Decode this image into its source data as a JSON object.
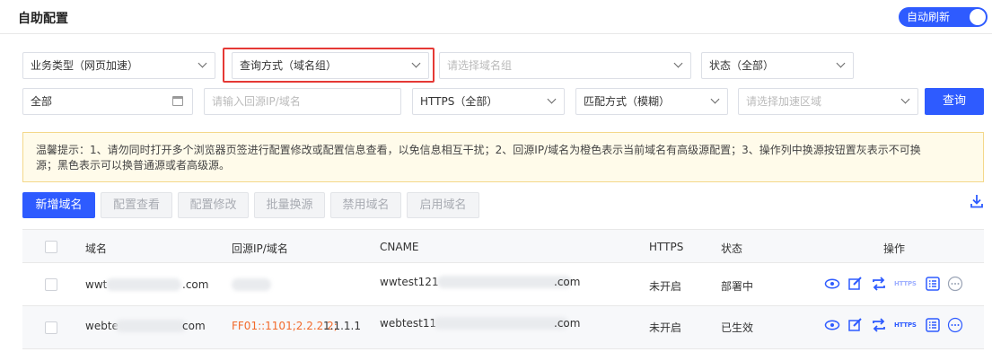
{
  "header": {
    "title": "自助配置",
    "auto_refresh": "自动刷新"
  },
  "filters": {
    "business_type": "业务类型（网页加速）",
    "query_mode": "查询方式（域名组）",
    "domain_group_placeholder": "请选择域名组",
    "status": "状态（全部）",
    "date": "全部",
    "origin_placeholder": "请输入回源IP/域名",
    "https": "HTTPS（全部）",
    "match_mode": "匹配方式（模糊）",
    "region_placeholder": "请选择加速区域",
    "query_button": "查询"
  },
  "notice": {
    "line1": "温馨提示：1、请勿同时打开多个浏览器页签进行配置修改或配置信息查看，以免信息相互干扰；2、回源IP/域名为橙色表示当前域名有高级源配置；3、操作列中换源按钮置灰表示不可换",
    "line2": "源；黑色表示可以换普通源或者高级源。"
  },
  "actions": {
    "add": "新增域名",
    "view": "配置查看",
    "edit": "配置修改",
    "batch_switch": "批量换源",
    "disable": "禁用域名",
    "enable": "启用域名"
  },
  "table": {
    "columns": {
      "domain": "域名",
      "origin": "回源IP/域名",
      "cname": "CNAME",
      "https": "HTTPS",
      "status": "状态",
      "ops": "操作"
    },
    "rows": [
      {
        "domain_prefix": "wwt",
        "domain_suffix": ".com",
        "origin": "",
        "cname_prefix": "wwtest121",
        "cname_suffix": ".com",
        "https": "未开启",
        "status": "部署中"
      },
      {
        "domain_prefix": "webte",
        "domain_suffix": "com",
        "origin": "FF01::1101;2.2.2.2;",
        "origin_tail": "1.1.1.1",
        "cname_prefix": "webtest11",
        "cname_suffix": ".com",
        "https": "未开启",
        "status": "已生效"
      }
    ],
    "op_icons": [
      "view-icon",
      "edit-icon",
      "switch-origin-icon",
      "https-icon",
      "detail-icon",
      "more-icon"
    ],
    "https_icon_label": "HTTPS"
  },
  "colors": {
    "primary": "#2e5bff",
    "origin_orange": "#f26a2b",
    "highlight": "#e53935"
  }
}
